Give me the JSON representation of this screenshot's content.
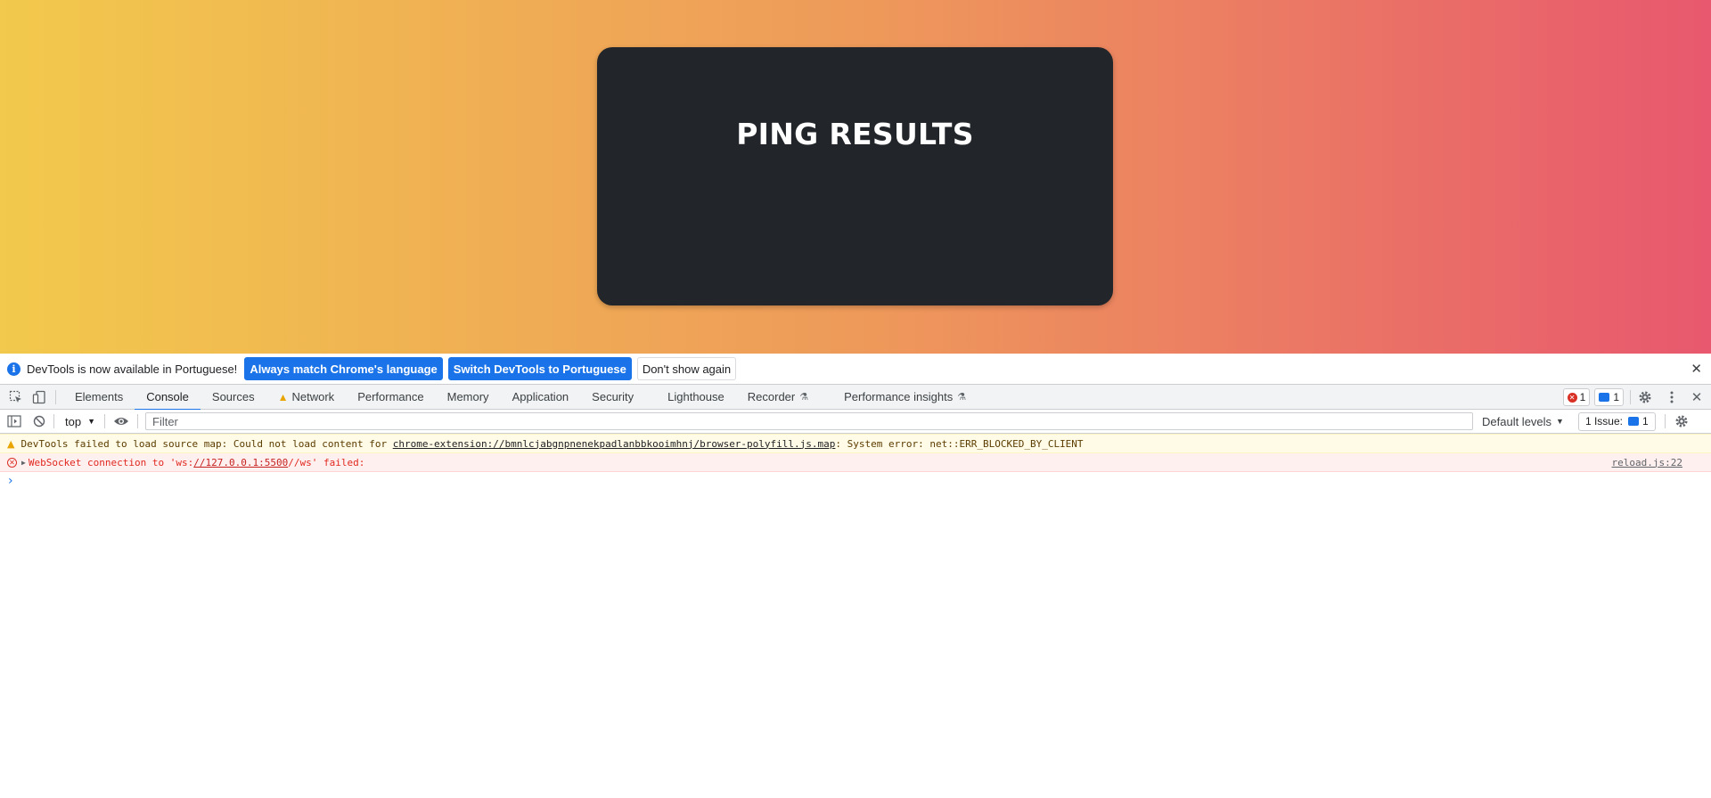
{
  "page": {
    "card_title": "PING RESULTS",
    "gradient_colors": [
      "#f2c94c",
      "#ee9a5a",
      "#e8586e"
    ]
  },
  "infobar": {
    "message": "DevTools is now available in Portuguese!",
    "btn_match_language": "Always match Chrome's language",
    "btn_switch": "Switch DevTools to Portuguese",
    "btn_dont_show": "Don't show again"
  },
  "tabs": {
    "elements": "Elements",
    "console": "Console",
    "sources": "Sources",
    "network": "Network",
    "performance": "Performance",
    "memory": "Memory",
    "application": "Application",
    "security": "Security",
    "lighthouse": "Lighthouse",
    "recorder": "Recorder",
    "performance_insights": "Performance insights",
    "active": "Console"
  },
  "counts": {
    "errors": "1",
    "messages": "1"
  },
  "filterbar": {
    "context": "top",
    "filter_placeholder": "Filter",
    "levels": "Default levels",
    "issues_label": "1 Issue:",
    "issues_count": "1"
  },
  "console": {
    "warning": {
      "prefix": "DevTools failed to load source map: Could not load content for ",
      "url": "chrome-extension://bmnlcjabgnpnenekpadlanbbkooimhnj/browser-polyfill.js.map",
      "suffix": ": System error: net::ERR_BLOCKED_BY_CLIENT"
    },
    "error": {
      "prefix": "WebSocket connection to 'ws:",
      "url": "//127.0.0.1:5500",
      "suffix": "//ws' failed:",
      "source": "reload.js:22"
    }
  }
}
